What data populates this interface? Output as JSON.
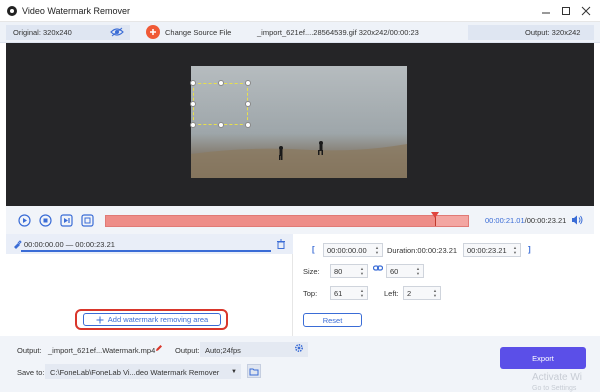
{
  "titlebar": {
    "title": "Video Watermark Remover"
  },
  "infobar": {
    "original": "Original: 320x240",
    "change_source": "Change Source File",
    "file_info": "_import_621ef....28564539.gif   320x242/00:00:23",
    "output": "Output: 320x242"
  },
  "timeline": {
    "current_time": "00:00:21.01",
    "total_time": "/00:00:23.21",
    "progress_percent": 91
  },
  "segment": {
    "range": "00:00:00.00  —  00:00:23.21"
  },
  "add_watermark_label": "Add watermark removing area",
  "range_fields": {
    "start": "00:00:00.00",
    "duration": "Duration:00:00:23.21",
    "end": "00:00:23.21"
  },
  "size": {
    "label": "Size:",
    "width": "80",
    "height": "60"
  },
  "position": {
    "top_label": "Top:",
    "top": "61",
    "left_label": "Left:",
    "left": "2"
  },
  "reset_label": "Reset",
  "bottom": {
    "output_label": "Output:",
    "output_file": "_import_621ef...Watermark.mp4",
    "format_label": "Output:",
    "format_value": "Auto;24fps",
    "save_label": "Save to:",
    "save_path": "C:\\FoneLab\\FoneLab Vi...deo Watermark Remover",
    "export_label": "Export"
  },
  "system_watermark": {
    "line1": "Activate Wi",
    "line2": "Go to Settings"
  }
}
